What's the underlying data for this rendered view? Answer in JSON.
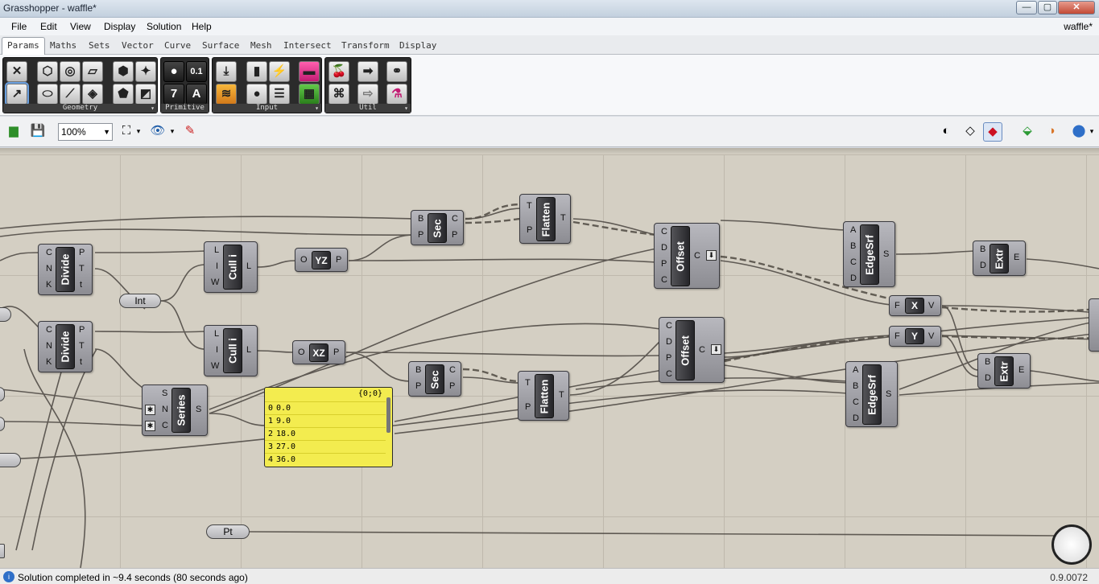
{
  "window": {
    "title": "Grasshopper - waffle*",
    "min": "—",
    "max": "▢",
    "close": "✕"
  },
  "menu": {
    "items": [
      "File",
      "Edit",
      "View",
      "Display",
      "Solution",
      "Help"
    ],
    "document": "waffle*"
  },
  "tabs": [
    "Params",
    "Maths",
    "Sets",
    "Vector",
    "Curve",
    "Surface",
    "Mesh",
    "Intersect",
    "Transform",
    "Display"
  ],
  "ribbon": {
    "panels": [
      "Geometry",
      "Primitive",
      "Input",
      "Util"
    ],
    "primitive_icons": [
      "0.1",
      "7",
      "A"
    ]
  },
  "toolbar": {
    "zoom": "100%"
  },
  "nodes": {
    "divide1": {
      "label": "Divide",
      "inputs": [
        "C",
        "N",
        "K"
      ],
      "outputs": [
        "P",
        "T",
        "t"
      ]
    },
    "divide2": {
      "label": "Divide",
      "inputs": [
        "C",
        "N",
        "K"
      ],
      "outputs": [
        "P",
        "T",
        "t"
      ]
    },
    "cull1": {
      "label": "Cull i",
      "inputs": [
        "L",
        "I",
        "W"
      ],
      "outputs": [
        "L"
      ]
    },
    "cull2": {
      "label": "Cull i",
      "inputs": [
        "L",
        "I",
        "W"
      ],
      "outputs": [
        "L"
      ]
    },
    "yz": {
      "label": "YZ",
      "inputs": [
        "O"
      ],
      "outputs": [
        "P"
      ]
    },
    "xz": {
      "label": "XZ",
      "inputs": [
        "O"
      ],
      "outputs": [
        "P"
      ]
    },
    "sec1": {
      "label": "Sec",
      "inputs": [
        "B",
        "P"
      ],
      "outputs": [
        "C",
        "P"
      ]
    },
    "sec2": {
      "label": "Sec",
      "inputs": [
        "B",
        "P"
      ],
      "outputs": [
        "C",
        "P"
      ]
    },
    "flatten1": {
      "label": "Flatten",
      "inputs": [
        "T",
        "P"
      ],
      "outputs": [
        "T"
      ]
    },
    "flatten2": {
      "label": "Flatten",
      "inputs": [
        "T",
        "P"
      ],
      "outputs": [
        "T"
      ]
    },
    "offset1": {
      "label": "Offset",
      "inputs": [
        "C",
        "D",
        "P",
        "C"
      ],
      "outputs": [
        "C"
      ]
    },
    "offset2": {
      "label": "Offset",
      "inputs": [
        "C",
        "D",
        "P",
        "C"
      ],
      "outputs": [
        "C"
      ]
    },
    "edgesrf1": {
      "label": "EdgeSrf",
      "inputs": [
        "A",
        "B",
        "C",
        "D"
      ],
      "outputs": [
        "S"
      ]
    },
    "edgesrf2": {
      "label": "EdgeSrf",
      "inputs": [
        "A",
        "B",
        "C",
        "D"
      ],
      "outputs": [
        "S"
      ]
    },
    "extr1": {
      "label": "Extr",
      "inputs": [
        "B",
        "D"
      ],
      "outputs": [
        "E"
      ]
    },
    "extr2": {
      "label": "Extr",
      "inputs": [
        "B",
        "D"
      ],
      "outputs": [
        "E"
      ]
    },
    "movex": {
      "label": "X",
      "inputs": [
        "F"
      ],
      "outputs": [
        "V"
      ]
    },
    "movey": {
      "label": "Y",
      "inputs": [
        "F"
      ],
      "outputs": [
        "V"
      ]
    },
    "series": {
      "label": "Series",
      "inputs": [
        "S",
        "N",
        "C"
      ],
      "outputs": [
        "S"
      ]
    },
    "int": {
      "label": "Int"
    },
    "pt": {
      "label": "Pt"
    }
  },
  "panel": {
    "path": "{0;0}",
    "rows": [
      {
        "i": "0",
        "v": "0.0"
      },
      {
        "i": "1",
        "v": "9.0"
      },
      {
        "i": "2",
        "v": "18.0"
      },
      {
        "i": "3",
        "v": "27.0"
      },
      {
        "i": "4",
        "v": "36.0"
      }
    ]
  },
  "status": {
    "message": "Solution completed in ~9.4 seconds (80 seconds ago)",
    "version": "0.9.0072"
  }
}
